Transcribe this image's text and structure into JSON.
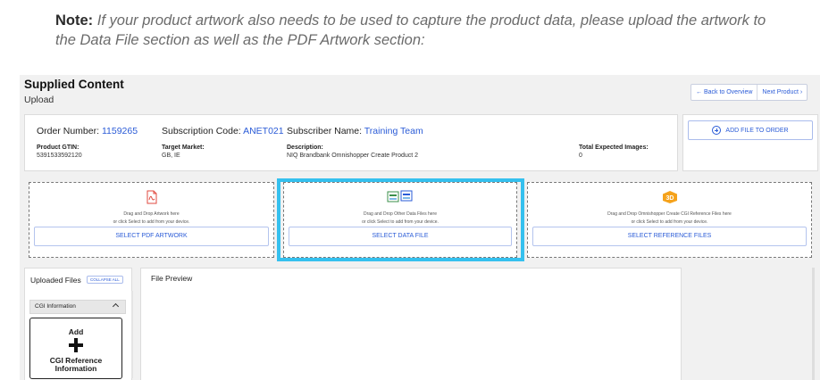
{
  "note": {
    "label": "Note",
    "text": "If your product artwork also needs to be used to capture the product data, please upload the artwork to the Data File section as well as the PDF Artwork section:"
  },
  "header": {
    "title": "Supplied Content",
    "subtitle": "Upload",
    "back_label": "← Back to Overview",
    "next_label": "Next Product ›"
  },
  "order": {
    "order_number_label": "Order Number:",
    "order_number": "1159265",
    "subscription_code_label": "Subscription Code:",
    "subscription_code": "ANET021",
    "subscriber_name_label": "Subscriber Name:",
    "subscriber_name": "Training Team",
    "gtin_label": "Product GTIN:",
    "gtin": "5391533592120",
    "market_label": "Target Market:",
    "market": "GB, IE",
    "description_label": "Description:",
    "description": "NIQ Brandbank Omnishopper Create Product 2",
    "images_label": "Total Expected Images:",
    "images": "0"
  },
  "add_file_label": "ADD FILE TO ORDER",
  "dropzones": {
    "pdf": {
      "line1": "Drag and Drop Artwork here",
      "line2": "or click Select to add from your device.",
      "button": "SELECT PDF ARTWORK"
    },
    "data": {
      "line1": "Drag and Drop Other Data Files here",
      "line2": "or click Select to add from your device.",
      "button": "SELECT DATA FILE"
    },
    "cgi": {
      "icon_text": "3D",
      "line1": "Drag and Drop Omnishopper Create CGI Reference Files here",
      "line2": "or click Select to add from your device.",
      "button": "SELECT REFERENCE FILES"
    }
  },
  "uploaded": {
    "title": "Uploaded Files",
    "collapse_label": "COLLAPSE ALL",
    "section_label": "CGI Information",
    "tile_add": "Add",
    "tile_label": "CGI Reference Information"
  },
  "preview": {
    "title": "File Preview"
  },
  "colors": {
    "accent": "#2a5bd7",
    "highlight": "#35c0ee",
    "pdf_icon": "#e04a3f",
    "cgi_icon": "#f5a21b"
  },
  "icons": [
    "pdf-file-icon",
    "data-file-icon",
    "3d-cube-icon",
    "add-circle-icon",
    "chevron-up-icon",
    "plus-icon"
  ]
}
